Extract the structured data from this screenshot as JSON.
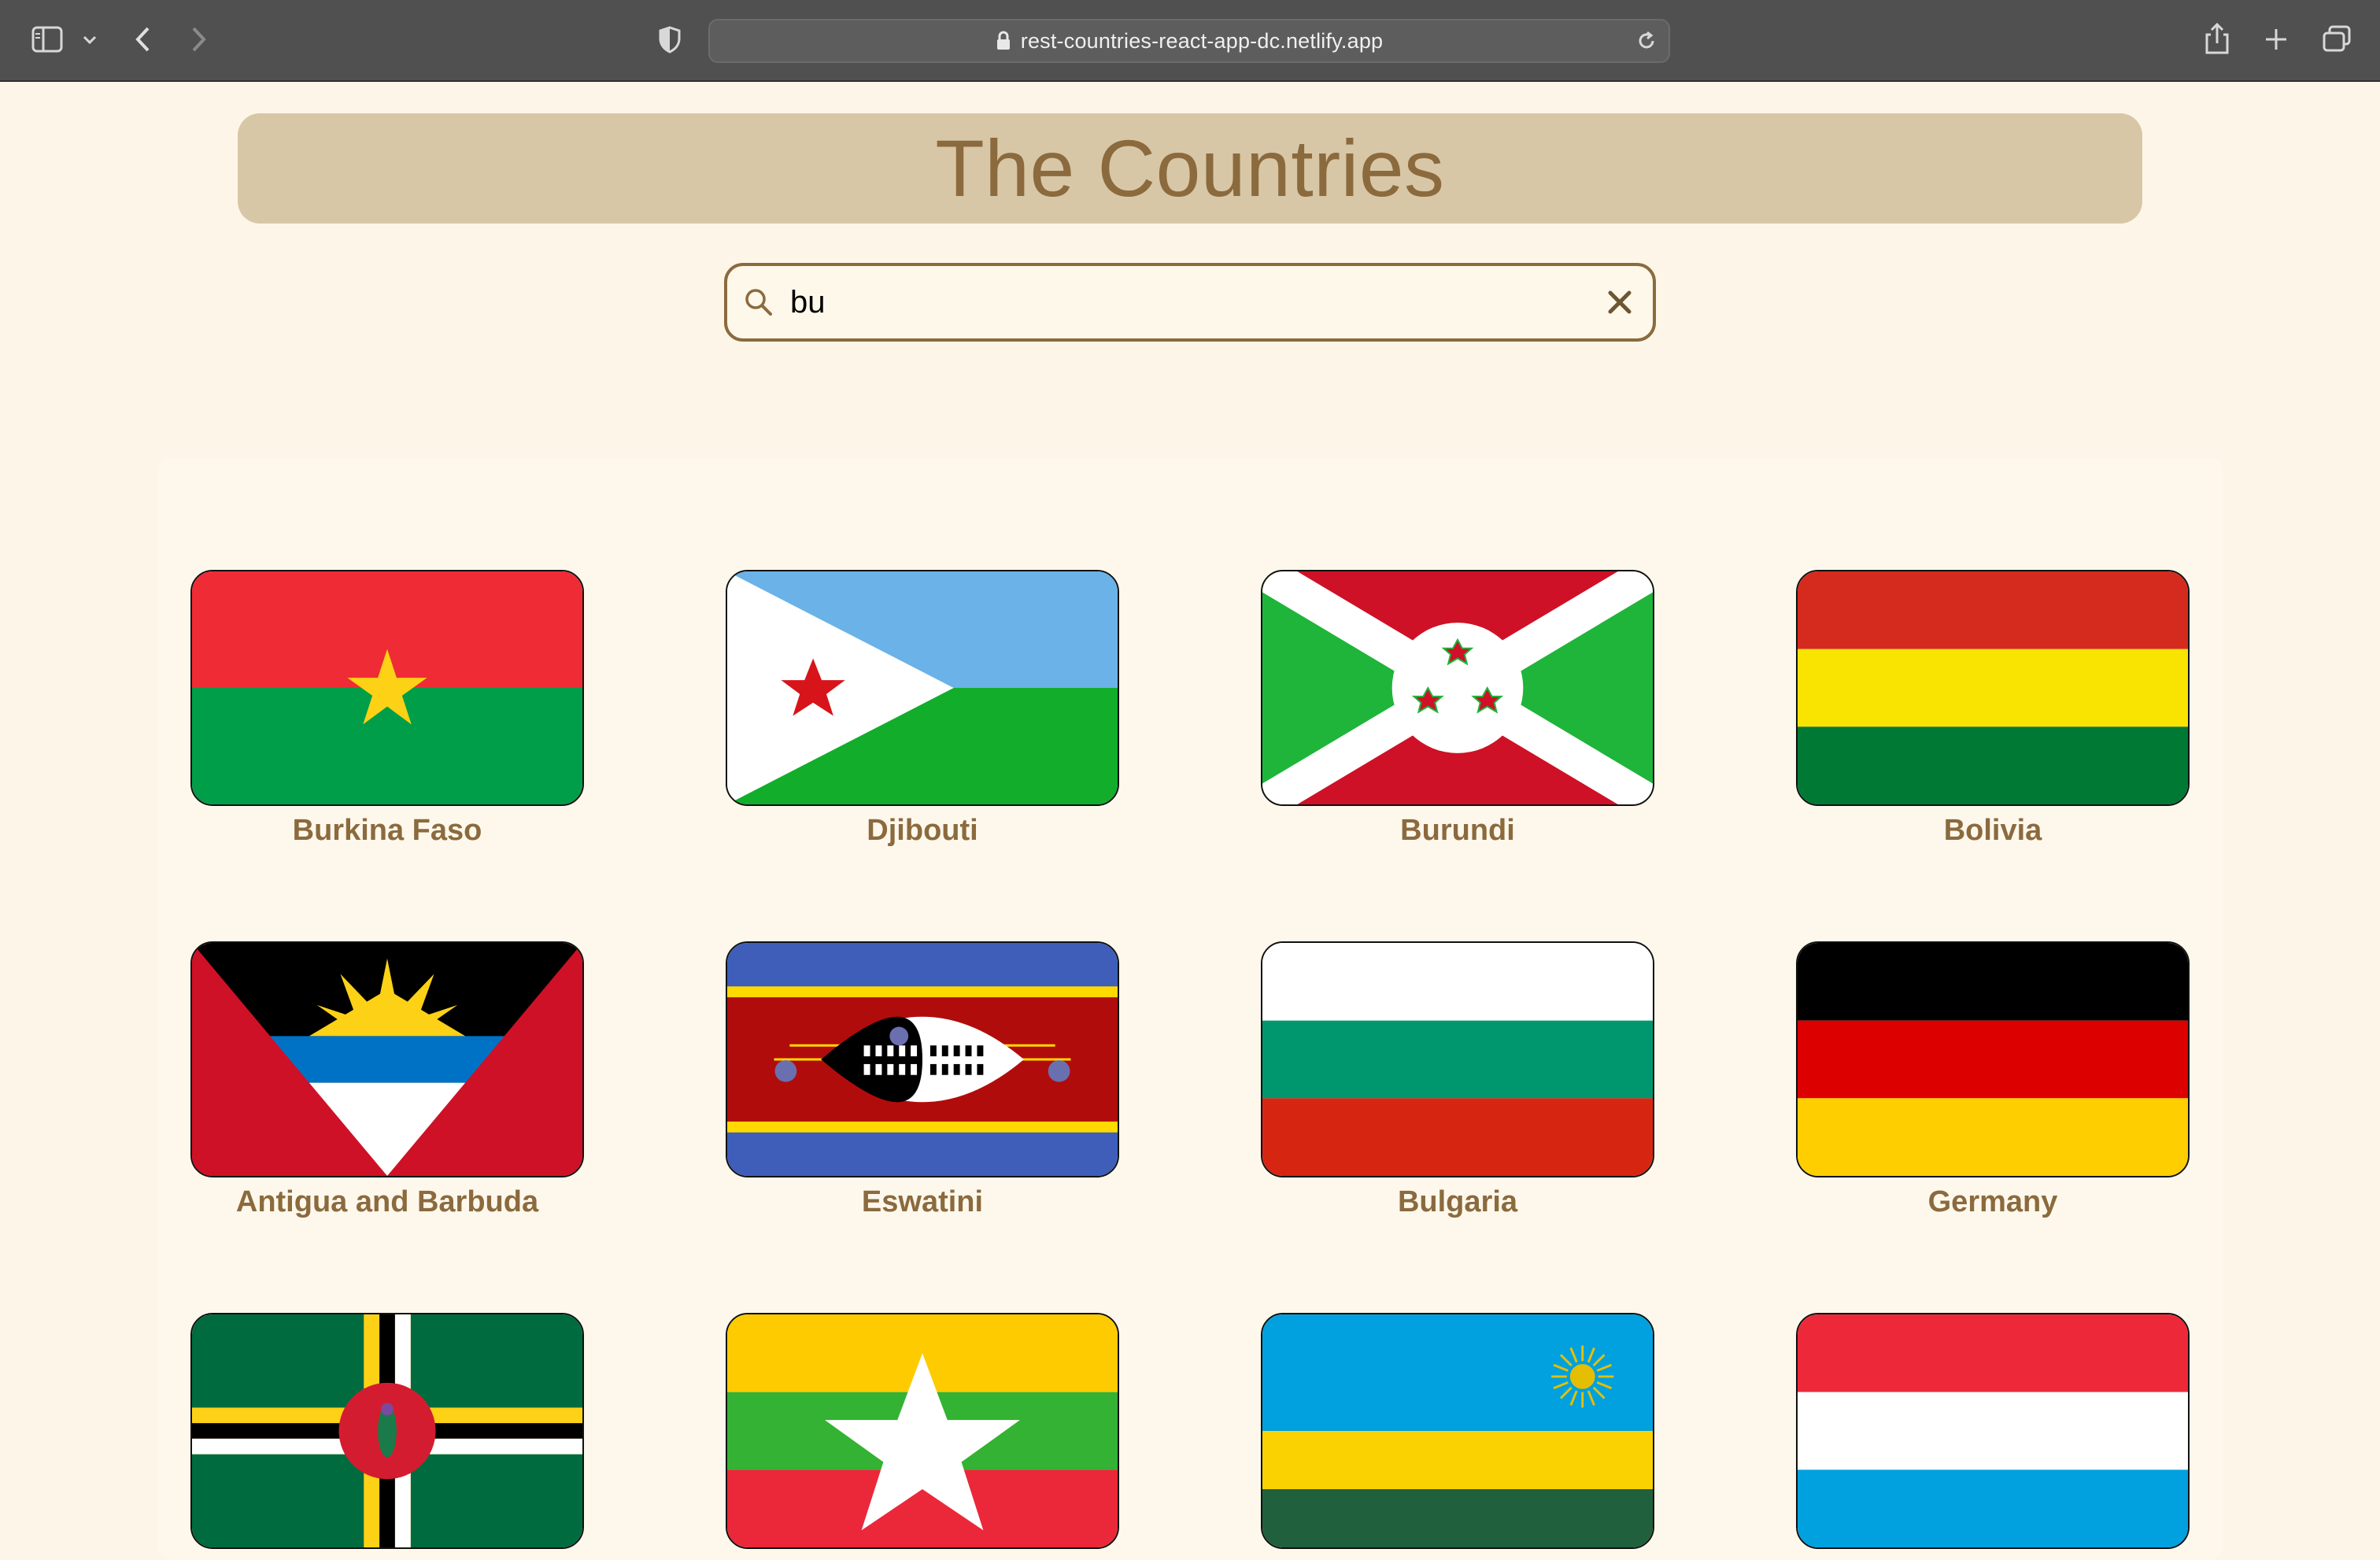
{
  "browser": {
    "url": "rest-countries-react-app-dc.netlify.app"
  },
  "page": {
    "title": "The Countries"
  },
  "search": {
    "value": "bu",
    "placeholder": ""
  },
  "countries": [
    {
      "name": "Burkina Faso",
      "flag": "burkina-faso"
    },
    {
      "name": "Djibouti",
      "flag": "djibouti"
    },
    {
      "name": "Burundi",
      "flag": "burundi"
    },
    {
      "name": "Bolivia",
      "flag": "bolivia"
    },
    {
      "name": "Antigua and Barbuda",
      "flag": "antigua-and-barbuda"
    },
    {
      "name": "Eswatini",
      "flag": "eswatini"
    },
    {
      "name": "Bulgaria",
      "flag": "bulgaria"
    },
    {
      "name": "Germany",
      "flag": "germany"
    },
    {
      "name": "",
      "flag": "dominica"
    },
    {
      "name": "",
      "flag": "myanmar"
    },
    {
      "name": "",
      "flag": "rwanda"
    },
    {
      "name": "",
      "flag": "luxembourg"
    }
  ],
  "colors": {
    "accent": "#8b6a3e",
    "banner": "#d8c7a6",
    "background": "#fdf6e8"
  }
}
